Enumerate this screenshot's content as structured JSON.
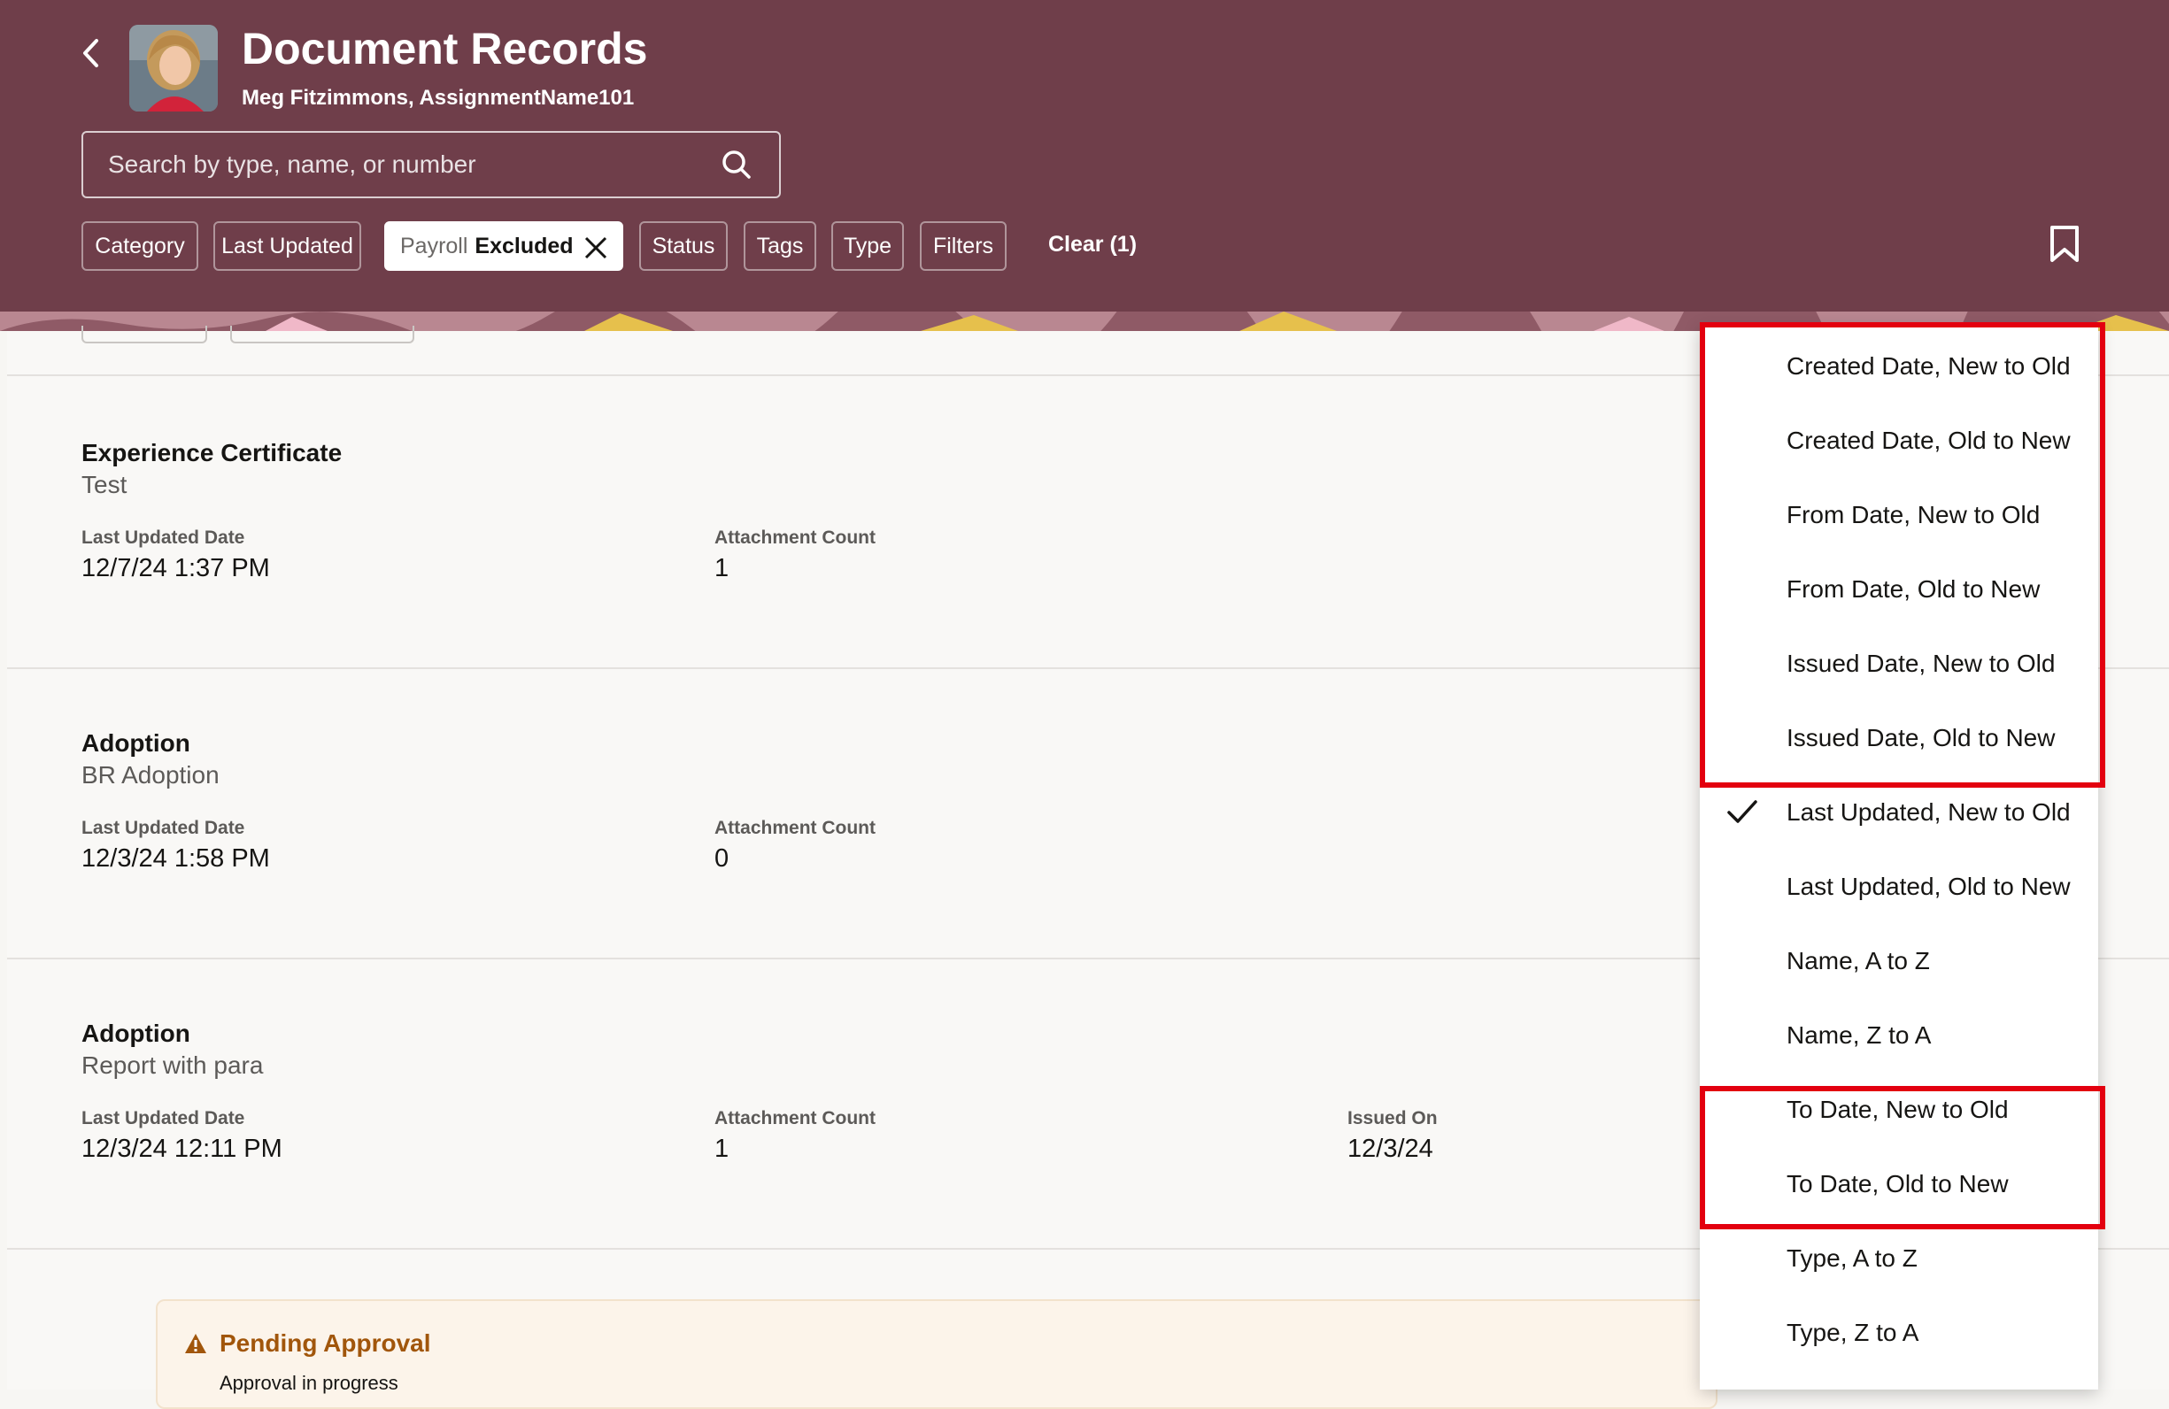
{
  "header": {
    "title": "Document Records",
    "subtitle": "Meg Fitzimmons, AssignmentName101",
    "search_placeholder": "Search by type, name, or number",
    "chips": {
      "category": "Category",
      "last_updated": "Last Updated",
      "payroll_label": "Payroll",
      "payroll_value": "Excluded",
      "status": "Status",
      "tags": "Tags",
      "type": "Type",
      "filters": "Filters"
    },
    "clear": "Clear (1)"
  },
  "records": [
    {
      "title": "Experience Certificate",
      "subtitle": "Test",
      "last_updated_label": "Last Updated Date",
      "last_updated": "12/7/24 1:37 PM",
      "attachment_label": "Attachment Count",
      "attachment_count": "1"
    },
    {
      "title": "Adoption",
      "subtitle": "BR Adoption",
      "last_updated_label": "Last Updated Date",
      "last_updated": "12/3/24 1:58 PM",
      "attachment_label": "Attachment Count",
      "attachment_count": "0"
    },
    {
      "title": "Adoption",
      "subtitle": "Report with para",
      "last_updated_label": "Last Updated Date",
      "last_updated": "12/3/24 12:11 PM",
      "attachment_label": "Attachment Count",
      "attachment_count": "1",
      "issued_label": "Issued On",
      "issued_on": "12/3/24"
    }
  ],
  "pending": {
    "title": "Pending Approval",
    "subtitle": "Approval in progress"
  },
  "sort_menu": {
    "selected_index": 6,
    "items": [
      "Created Date, New to Old",
      "Created Date, Old to New",
      "From Date, New to Old",
      "From Date, Old to New",
      "Issued Date, New to Old",
      "Issued Date, Old to New",
      "Last Updated, New to Old",
      "Last Updated, Old to New",
      "Name, A to Z",
      "Name, Z to A",
      "To Date, New to Old",
      "To Date, Old to New",
      "Type, A to Z",
      "Type, Z to A"
    ]
  },
  "colors": {
    "header": "#6f3e4a",
    "highlight": "#e3000f",
    "warning": "#a1560b"
  }
}
